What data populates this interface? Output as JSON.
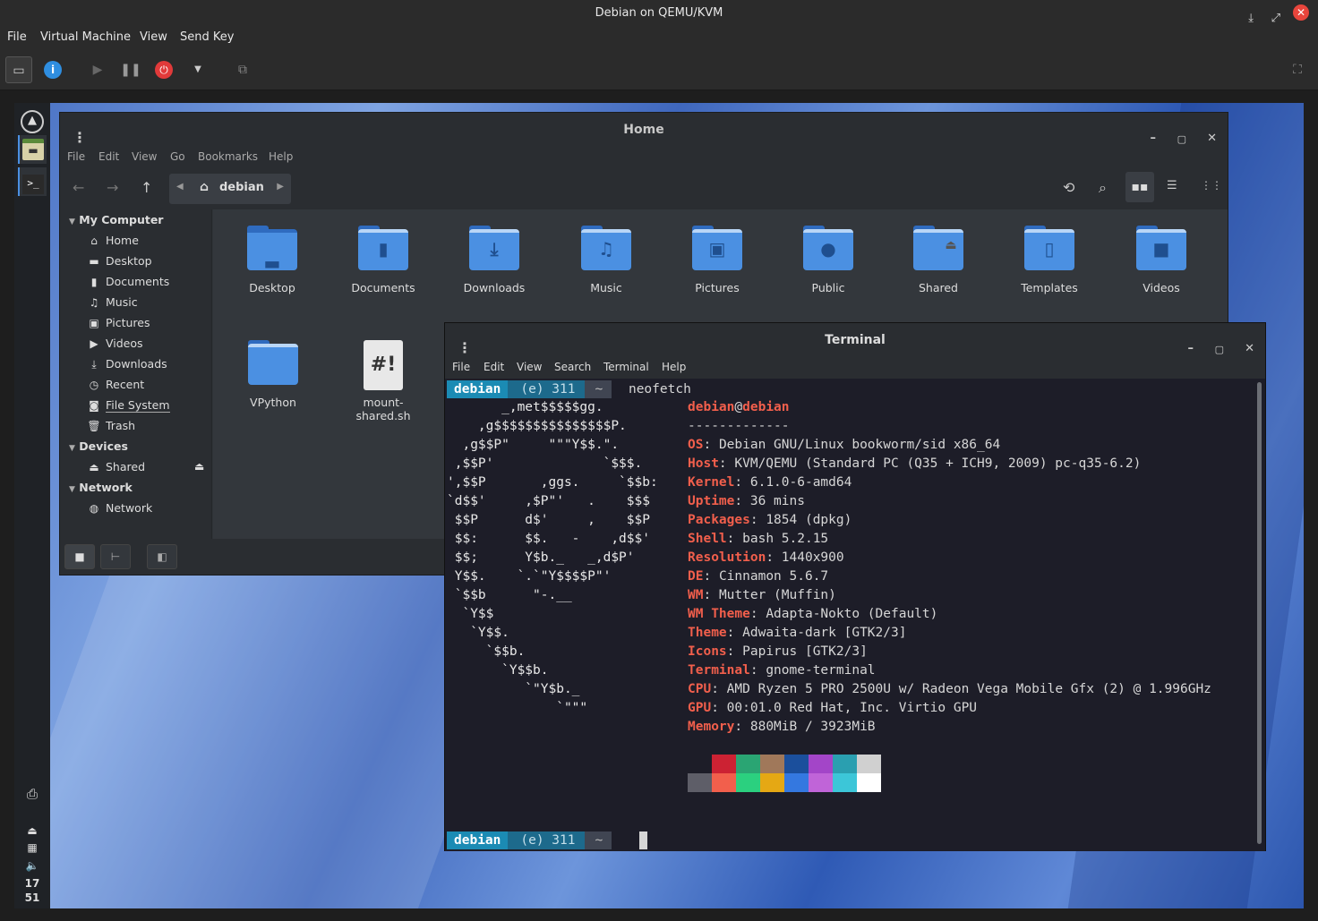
{
  "vm": {
    "title": "Debian on QEMU/KVM",
    "menu": [
      "File",
      "Virtual Machine",
      "View",
      "Send Key"
    ]
  },
  "panel": {
    "clock_hour": "17",
    "clock_min": "51"
  },
  "nemo": {
    "title": "Home",
    "menu": [
      "File",
      "Edit",
      "View",
      "Go",
      "Bookmarks",
      "Help"
    ],
    "breadcrumb": "debian",
    "sidebar": {
      "my_computer": "My Computer",
      "items": [
        "Home",
        "Desktop",
        "Documents",
        "Music",
        "Pictures",
        "Videos",
        "Downloads",
        "Recent",
        "File System",
        "Trash"
      ],
      "devices": "Devices",
      "device_items": [
        "Shared"
      ],
      "network": "Network",
      "network_items": [
        "Network"
      ]
    },
    "files": [
      "Desktop",
      "Documents",
      "Downloads",
      "Music",
      "Pictures",
      "Public",
      "Shared",
      "Templates",
      "Videos",
      "VPython",
      "mount-shared.sh"
    ]
  },
  "terminal": {
    "title": "Terminal",
    "menu": [
      "File",
      "Edit",
      "View",
      "Search",
      "Terminal",
      "Help"
    ],
    "prompt": {
      "user": "debian",
      "count": "(e) 311",
      "dir": "~"
    },
    "command": "neofetch",
    "userhost": {
      "user": "debian",
      "at": "@",
      "host": "debian"
    },
    "separator": "-------------",
    "info": [
      {
        "k": "OS",
        "v": "Debian GNU/Linux bookworm/sid x86_64"
      },
      {
        "k": "Host",
        "v": "KVM/QEMU (Standard PC (Q35 + ICH9, 2009) pc-q35-6.2)"
      },
      {
        "k": "Kernel",
        "v": "6.1.0-6-amd64"
      },
      {
        "k": "Uptime",
        "v": "36 mins"
      },
      {
        "k": "Packages",
        "v": "1854 (dpkg)"
      },
      {
        "k": "Shell",
        "v": "bash 5.2.15"
      },
      {
        "k": "Resolution",
        "v": "1440x900"
      },
      {
        "k": "DE",
        "v": "Cinnamon 5.6.7"
      },
      {
        "k": "WM",
        "v": "Mutter (Muffin)"
      },
      {
        "k": "WM Theme",
        "v": "Adapta-Nokto (Default)"
      },
      {
        "k": "Theme",
        "v": "Adwaita-dark [GTK2/3]"
      },
      {
        "k": "Icons",
        "v": "Papirus [GTK2/3]"
      },
      {
        "k": "Terminal",
        "v": "gnome-terminal"
      },
      {
        "k": "CPU",
        "v": "AMD Ryzen 5 PRO 2500U w/ Radeon Vega Mobile Gfx (2) @ 1.996GHz"
      },
      {
        "k": "GPU",
        "v": "00:01.0 Red Hat, Inc. Virtio GPU"
      },
      {
        "k": "Memory",
        "v": "880MiB / 3923MiB"
      }
    ],
    "ascii": [
      "       _,met$$$$$gg.",
      "    ,g$$$$$$$$$$$$$$$P.",
      "  ,g$$P\"     \"\"\"Y$$.\".",
      " ,$$P'              `$$$.",
      "',$$P       ,ggs.     `$$b:",
      "`d$$'     ,$P\"'   .    $$$",
      " $$P      d$'     ,    $$P",
      " $$:      $$.   -    ,d$$'",
      " $$;      Y$b._   _,d$P'",
      " Y$$.    `.`\"Y$$$$P\"'",
      " `$$b      \"-.__",
      "  `Y$$",
      "   `Y$$.",
      "     `$$b.",
      "       `Y$$b.",
      "          `\"Y$b._",
      "              `\"\"\""
    ],
    "palette_top": [
      "#1d1d28",
      "#cc2233",
      "#2aa573",
      "#a0785a",
      "#1b4f9c",
      "#a345c8",
      "#2a9fb0",
      "#d0d0d0"
    ],
    "palette_bottom": [
      "#5e5e68",
      "#f25f4c",
      "#2bd07f",
      "#e5a814",
      "#3478e0",
      "#c064d8",
      "#3cc6d8",
      "#ffffff"
    ]
  }
}
